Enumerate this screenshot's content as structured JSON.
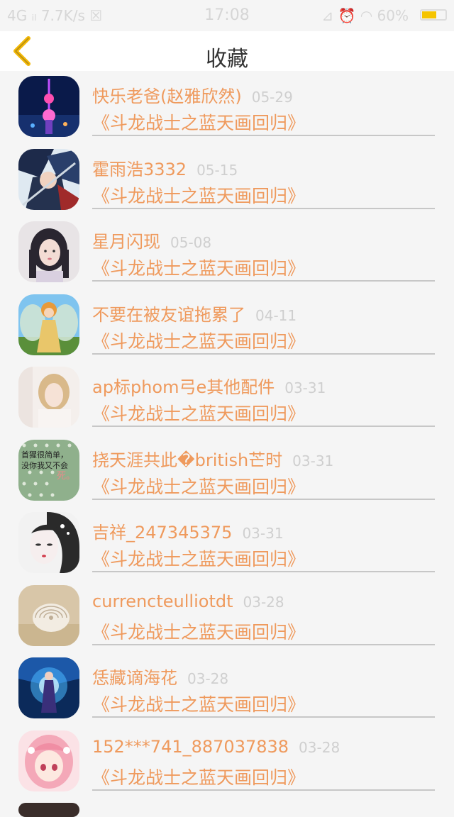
{
  "status_bar": {
    "left": "4G ᵢₗ 7.7K/s ☒",
    "time": "17:08",
    "right": "⊿ ⏰ ◠ 60%",
    "battery_level": 0.6
  },
  "nav": {
    "back_icon": "chevron-left-icon",
    "title": "收藏",
    "accent": "#f2b705"
  },
  "colors": {
    "text_accent": "#ef9a5d",
    "date_text": "#cfcfcf"
  },
  "items": [
    {
      "name": "快乐老爸(赵雅欣然)",
      "date": "05-29",
      "title": "《斗龙战士之蓝天画回归》",
      "avatar": "tower-night-avatar"
    },
    {
      "name": "霍雨浩3332",
      "date": "05-15",
      "title": "《斗龙战士之蓝天画回归》",
      "avatar": "anime-warrior-avatar"
    },
    {
      "name": "星月闪现",
      "date": "05-08",
      "title": "《斗龙战士之蓝天画回归》",
      "avatar": "girl-portrait-avatar"
    },
    {
      "name": "不要在被友谊拖累了",
      "date": "04-11",
      "title": "《斗龙战士之蓝天画回归》",
      "avatar": "fairy-avatar"
    },
    {
      "name": "ap标phom弓e其他配件",
      "date": "03-31",
      "title": "《斗龙战士之蓝天画回归》",
      "avatar": "blonde-girl-avatar"
    },
    {
      "name": "挠天涯共此�british芒时",
      "date": "03-31",
      "title": "《斗龙战士之蓝天画回归》",
      "avatar": "text-polka-avatar"
    },
    {
      "name": "吉祥_247345375",
      "date": "03-31",
      "title": "《斗龙战士之蓝天画回归》",
      "avatar": "ink-portrait-avatar"
    },
    {
      "name": "currencteulliotdt",
      "date": "03-28",
      "title": "《斗龙战士之蓝天画回归》",
      "avatar": "seashell-avatar"
    },
    {
      "name": "恁藏谪海花",
      "date": "03-28",
      "title": "《斗龙战士之蓝天画回归》",
      "avatar": "blue-hero-avatar"
    },
    {
      "name": "152***741_887037838",
      "date": "03-28",
      "title": "《斗龙战士之蓝天画回归》",
      "avatar": "pink-anime-avatar"
    }
  ],
  "avatar_text": {
    "line1": "首猩很简单，",
    "line2": "没你我又不会",
    "line3": "死。"
  }
}
